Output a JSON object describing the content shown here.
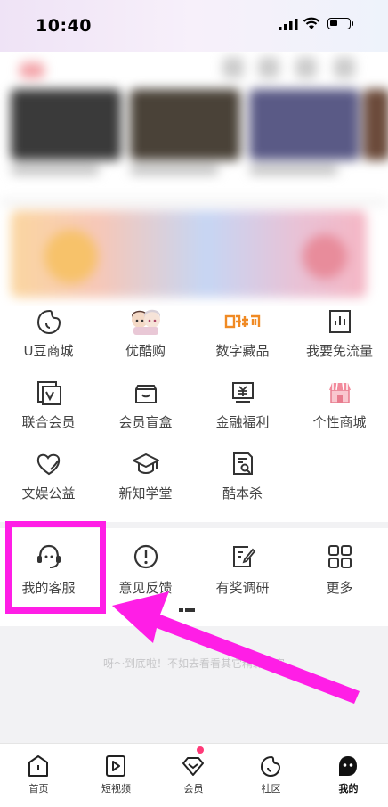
{
  "status_bar": {
    "time": "10:40"
  },
  "services": [
    {
      "label": "U豆商城",
      "icon": "u-bean-icon"
    },
    {
      "label": "优酷购",
      "icon": "anime-characters-icon"
    },
    {
      "label": "数字藏品",
      "icon": "digital-collection-logo-icon"
    },
    {
      "label": "我要免流量",
      "icon": "data-chart-icon"
    },
    {
      "label": "联合会员",
      "icon": "joint-vip-icon"
    },
    {
      "label": "会员盲盒",
      "icon": "blind-box-icon"
    },
    {
      "label": "金融福利",
      "icon": "finance-icon"
    },
    {
      "label": "个性商城",
      "icon": "shop-icon"
    },
    {
      "label": "文娱公益",
      "icon": "charity-heart-icon"
    },
    {
      "label": "新知学堂",
      "icon": "graduation-cap-icon"
    },
    {
      "label": "酷本杀",
      "icon": "script-search-icon"
    }
  ],
  "services_row2": [
    {
      "label": "我的客服",
      "icon": "customer-service-icon"
    },
    {
      "label": "意见反馈",
      "icon": "exclamation-icon"
    },
    {
      "label": "有奖调研",
      "icon": "survey-edit-icon"
    },
    {
      "label": "更多",
      "icon": "more-grid-icon"
    }
  ],
  "footer": {
    "text": "呀～到底啦！不如去看看其它精彩内容"
  },
  "tabs": [
    {
      "label": "首页",
      "icon": "home-icon"
    },
    {
      "label": "短视频",
      "icon": "play-video-icon"
    },
    {
      "label": "会员",
      "icon": "diamond-icon"
    },
    {
      "label": "社区",
      "icon": "community-icon"
    },
    {
      "label": "我的",
      "icon": "profile-icon"
    }
  ],
  "colors": {
    "highlight": "#ff1ee6",
    "orange": "#f08a24",
    "notify_dot": "#ff3a78"
  }
}
